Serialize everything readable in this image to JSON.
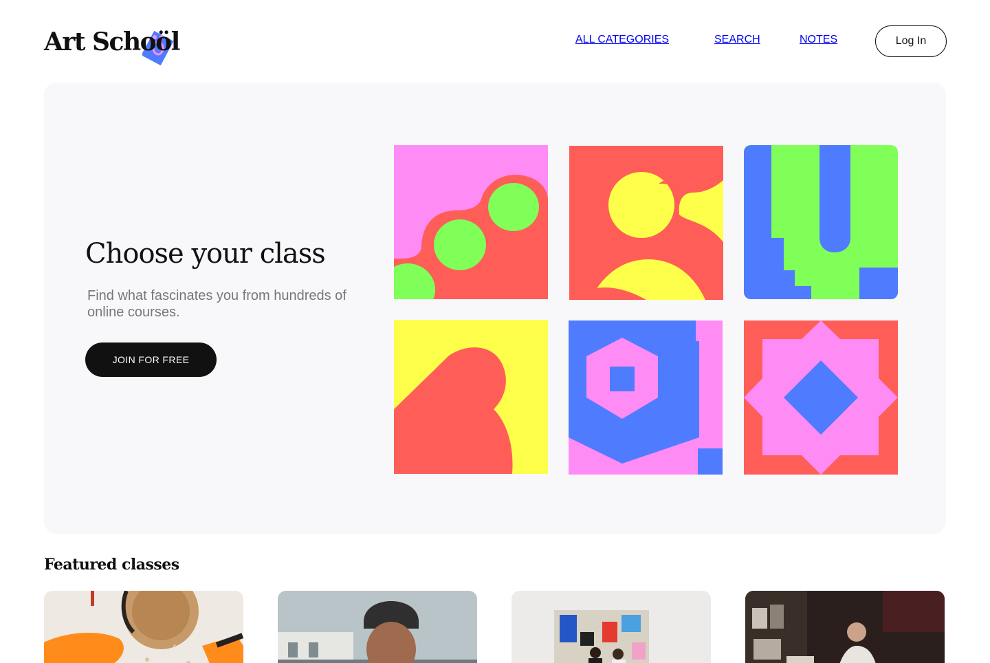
{
  "brand": {
    "name": "Art Schoöl",
    "logo_text": "Art Schoöl",
    "logo_mark_icon": "tilted-blue-square-icon",
    "accent_blue": "#4f7bff",
    "accent_pink": "#ff8cf5"
  },
  "nav": {
    "items": [
      {
        "label": "ALL CATEGORIES"
      },
      {
        "label": "SEARCH"
      },
      {
        "label": "NOTES"
      }
    ],
    "login_label": "Log In"
  },
  "hero": {
    "title": "Choose your class",
    "subtitle": "Find what fascinates you from hundreds of online courses.",
    "cta_label": "JOIN FOR FREE",
    "background": "#f8f8fa",
    "palette": {
      "pink": "#ff8cf5",
      "red": "#ff5d57",
      "green": "#80ff58",
      "yellow": "#fdff4a",
      "blue": "#4f7bff"
    }
  },
  "featured": {
    "title": "Featured classes",
    "cards": [
      {
        "image": "pottery-gloved-hands-photo"
      },
      {
        "image": "man-in-beanie-photo"
      },
      {
        "image": "gallery-painting-viewers-photo"
      },
      {
        "image": "studio-artist-drawing-photo"
      }
    ]
  }
}
